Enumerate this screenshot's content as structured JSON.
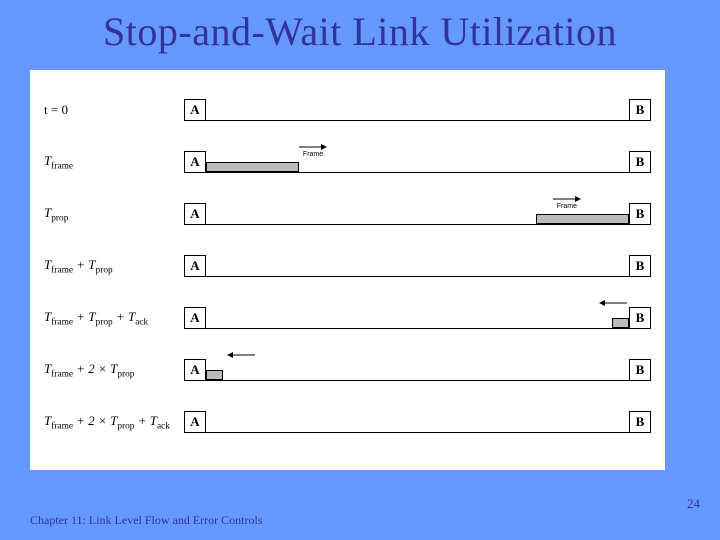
{
  "title": "Stop-and-Wait Link Utilization",
  "footer": "Chapter 11: Link Level Flow and Error Controls",
  "page_number": "24",
  "node_a": "A",
  "node_b": "B",
  "arrow_label": "Frame",
  "rows": [
    {
      "label_html": "<span class='up'>t = 0</span>",
      "frame": null,
      "arrow": null
    },
    {
      "label_html": "T<sub>frame</sub>",
      "frame": {
        "left_pct": 0,
        "width_pct": 22
      },
      "arrow": {
        "pos_pct": 22,
        "dir": "right",
        "label": true
      }
    },
    {
      "label_html": "T<sub>prop</sub>",
      "frame": {
        "left_pct": 78,
        "width_pct": 22
      },
      "arrow": {
        "pos_pct": 82,
        "dir": "right",
        "label": true
      }
    },
    {
      "label_html": "T<sub>frame</sub> + T<sub>prop</sub>",
      "frame": null,
      "arrow": null
    },
    {
      "label_html": "T<sub>frame</sub> + T<sub>prop</sub> + T<sub>ack</sub>",
      "frame": {
        "left_pct": 96,
        "width_pct": 4
      },
      "arrow": {
        "pos_pct": 93,
        "dir": "left",
        "label": false
      }
    },
    {
      "label_html": "T<sub>frame</sub> + 2 × T<sub>prop</sub>",
      "frame": {
        "left_pct": 0,
        "width_pct": 4
      },
      "arrow": {
        "pos_pct": 5,
        "dir": "left",
        "label": false
      }
    },
    {
      "label_html": "T<sub>frame</sub> + 2 × T<sub>prop</sub> + T<sub>ack</sub>",
      "frame": null,
      "arrow": null
    }
  ]
}
